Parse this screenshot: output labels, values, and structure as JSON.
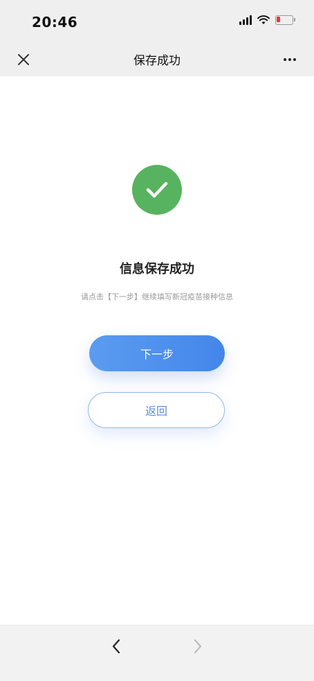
{
  "status_bar": {
    "time": "20:46",
    "battery_color": "#e53935"
  },
  "nav": {
    "title": "保存成功"
  },
  "content": {
    "title": "信息保存成功",
    "subtitle": "请点击【下一步】继续填写新冠疫苗接种信息",
    "next_button_label": "下一步",
    "back_button_label": "返回",
    "success_color": "#57b35f",
    "accent_color": "#4386ea"
  },
  "icons": {
    "close": "close-icon",
    "more": "more-icon",
    "check": "check-icon",
    "back": "chevron-left-icon",
    "forward": "chevron-right-icon",
    "signal": "signal-icon",
    "wifi": "wifi-icon",
    "battery": "battery-icon"
  }
}
